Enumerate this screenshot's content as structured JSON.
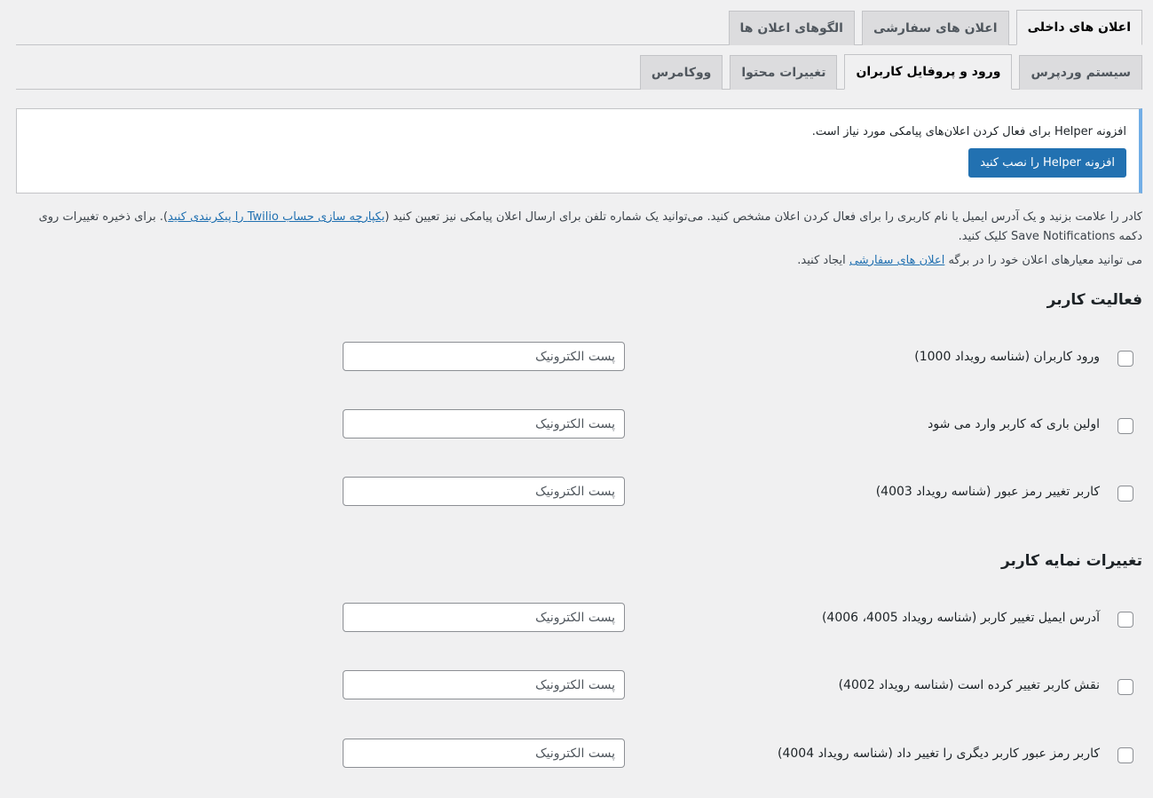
{
  "tabs_primary": [
    {
      "label": "اعلان های داخلی",
      "active": true
    },
    {
      "label": "اعلان های سفارشی",
      "active": false
    },
    {
      "label": "الگوهای اعلان ها",
      "active": false
    }
  ],
  "tabs_secondary": [
    {
      "label": "سیستم وردپرس",
      "active": false
    },
    {
      "label": "ورود و پروفایل کاربران",
      "active": true
    },
    {
      "label": "تغییرات محتوا",
      "active": false
    },
    {
      "label": "ووکامرس",
      "active": false
    }
  ],
  "notice": {
    "text": "افزونه Helper برای فعال کردن اعلان‌های پیامکی مورد نیاز است.",
    "button_label": "افزونه Helper را نصب کنید"
  },
  "description": {
    "part1": "کادر را علامت بزنید و یک آدرس ایمیل یا نام کاربری را برای فعال کردن اعلان مشخص کنید. می‌توانید یک شماره تلفن برای ارسال اعلان پیامکی نیز تعیین کنید (",
    "link": "یکپارچه سازی حساب Twilio را پیکربندی کنید",
    "part2": "). برای ذخیره تغییرات روی دکمه Save Notifications کلیک کنید.",
    "line2_part1": "می توانید معیارهای اعلان خود را در برگه ",
    "line2_link": "اعلان های سفارشی",
    "line2_part2": " ایجاد کنید."
  },
  "sections": [
    {
      "title": "فعالیت کاربر",
      "rows": [
        {
          "label": "ورود کاربران (شناسه رویداد 1000)",
          "placeholder": "پست الکترونیک"
        },
        {
          "label": "اولین باری که کاربر وارد می شود",
          "placeholder": "پست الکترونیک"
        },
        {
          "label": "کاربر تغییر رمز عبور (شناسه رویداد 4003)",
          "placeholder": "پست الکترونیک"
        }
      ]
    },
    {
      "title": "تغییرات نمایه کاربر",
      "rows": [
        {
          "label": "آدرس ایمیل تغییر کاربر (شناسه رویداد 4005، 4006)",
          "placeholder": "پست الکترونیک"
        },
        {
          "label": "نقش کاربر تغییر کرده است (شناسه رویداد 4002)",
          "placeholder": "پست الکترونیک"
        },
        {
          "label": "کاربر رمز عبور کاربر دیگری را تغییر داد (شناسه رویداد 4004)",
          "placeholder": "پست الکترونیک"
        }
      ]
    }
  ]
}
